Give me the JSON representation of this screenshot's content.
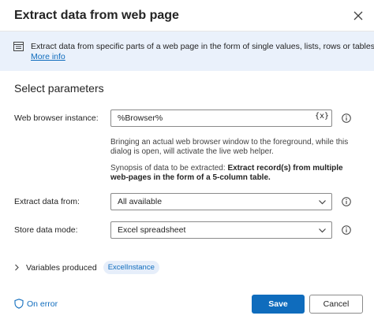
{
  "dialog": {
    "title": "Extract data from web page"
  },
  "info": {
    "text": "Extract data from specific parts of a web page in the form of single values, lists, rows or tables",
    "more_info": "More info"
  },
  "params": {
    "section_title": "Select parameters",
    "browser": {
      "label": "Web browser instance:",
      "value": "%Browser%",
      "var_button": "{x}"
    },
    "desc1": "Bringing an actual web browser window to the foreground, while this dialog is open, will activate the live web helper.",
    "desc2_prefix": "Synopsis of data to be extracted: ",
    "desc2_bold": "Extract record(s) from multiple web-pages in the form of a 5-column table.",
    "extract_from": {
      "label": "Extract data from:",
      "value": "All available"
    },
    "store_mode": {
      "label": "Store data mode:",
      "value": "Excel spreadsheet"
    }
  },
  "variables": {
    "label": "Variables produced",
    "chip": "ExcelInstance"
  },
  "footer": {
    "on_error": "On error",
    "save": "Save",
    "cancel": "Cancel"
  },
  "colors": {
    "accent": "#0f6cbd",
    "info_bg": "#eaf1fb"
  }
}
